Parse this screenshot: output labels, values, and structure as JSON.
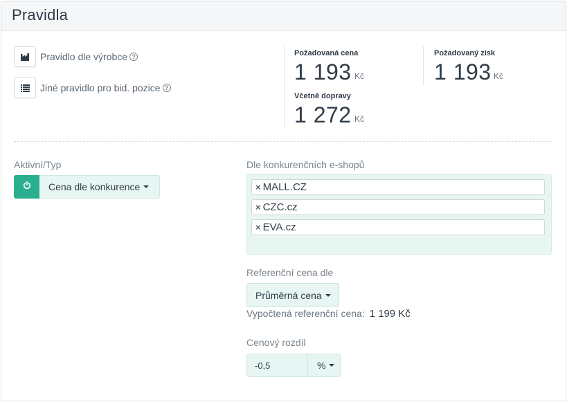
{
  "header": {
    "title": "Pravidla"
  },
  "rules": {
    "manufacturer": {
      "label": "Pravidlo dle výrobce",
      "icon": "factory-icon"
    },
    "bid_position": {
      "label": "Jiné pravidlo pro bid. pozice",
      "icon": "list-icon"
    },
    "help_glyph": "?"
  },
  "stats": {
    "required_price": {
      "label": "Požadovaná cena",
      "value": "1 193",
      "unit": "Kč"
    },
    "required_profit": {
      "label": "Požadovaný zisk",
      "value": "1 193",
      "unit": "Kč"
    },
    "incl_shipping": {
      "label": "Včetně dopravy",
      "value": "1 272",
      "unit": "Kč"
    }
  },
  "active_type": {
    "label": "Aktivní/Typ",
    "value": "Cena dle konkurence",
    "power_color": "#2bae8f"
  },
  "competitors": {
    "label": "Dle konkurenčních e-shopů",
    "remove_glyph": "×",
    "shops": [
      "MALL.CZ",
      "CZC.cz",
      "EVA.cz"
    ]
  },
  "reference": {
    "label": "Referenční cena dle",
    "value": "Průměrná cena",
    "calc_label": "Vypočtená referenční cena:",
    "calc_value": "1 199 Kč"
  },
  "price_diff": {
    "label": "Cenový rozdíl",
    "value": "-0,5",
    "unit": "%"
  }
}
